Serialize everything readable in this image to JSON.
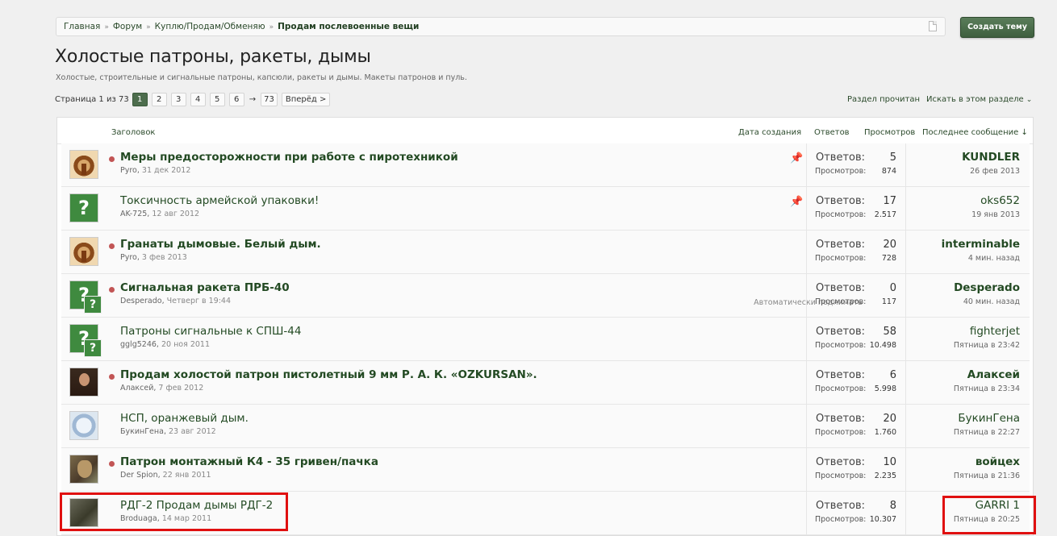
{
  "breadcrumb": {
    "items": [
      "Главная",
      "Форум",
      "Куплю/Продам/Обменяю"
    ],
    "current": "Продам послевоенные вещи"
  },
  "create_button": "Создать тему",
  "title": "Холостые патроны, ракеты, дымы",
  "description": "Холостые, строительные и сигнальные патроны, капсюли, ракеты и дымы. Макеты патронов и пуль.",
  "pagination": {
    "label": "Страница 1 из 73",
    "pages": [
      "1",
      "2",
      "3",
      "4",
      "5",
      "6"
    ],
    "current": "1",
    "arrow": "→",
    "last": "73",
    "next": "Вперёд >"
  },
  "links": {
    "mark_read": "Раздел прочитан",
    "search_section": "Искать в этом разделе"
  },
  "columns": {
    "title": "Заголовок",
    "created": "Дата создания",
    "replies": "Ответов",
    "views": "Просмотров",
    "last_post": "Последнее сообщение ↓"
  },
  "stat_labels": {
    "replies": "Ответов:",
    "views": "Просмотров:"
  },
  "threads": [
    {
      "title": "Меры предосторожности при работе с пиротехникой",
      "author": "Pyro",
      "date": "31 дек 2012",
      "replies": "5",
      "views": "874",
      "last_user": "KUNDLER",
      "last_time": "26 фев 2013",
      "unread": true,
      "sticky": true,
      "avatar": "pyro-avatar"
    },
    {
      "title": "Токсичность армейской упаковки!",
      "author": "AK-725",
      "date": "12 авг 2012",
      "replies": "17",
      "views": "2.517",
      "last_user": "oks652",
      "last_time": "19 янв 2013",
      "unread": false,
      "sticky": true,
      "avatar": "question-avatar"
    },
    {
      "title": "Гранаты дымовые. Белый дым.",
      "author": "Pyro",
      "date": "3 фев 2013",
      "replies": "20",
      "views": "728",
      "last_user": "interminable",
      "last_time": "4 мин. назад",
      "unread": true,
      "sticky": false,
      "avatar": "pyro-avatar"
    },
    {
      "title": "Сигнальная ракета ПРБ-40",
      "author": "Desperado",
      "date": "Четверг в 19:44",
      "replies": "0",
      "views": "117",
      "last_user": "Desperado",
      "last_time": "40 мин. назад",
      "unread": true,
      "sticky": false,
      "avatar": "question-avatar",
      "note": "Автоматически поднимать"
    },
    {
      "title": "Патроны сигнальные к СПШ-44",
      "author": "gglg5246",
      "date": "20 ноя 2011",
      "replies": "58",
      "views": "10.498",
      "last_user": "fighterjet",
      "last_time": "Пятница в 23:42",
      "unread": false,
      "sticky": false,
      "avatar": "question-avatar"
    },
    {
      "title": "Продам холостой патрон пистолетный 9 мм Р. А. К. «OZKURSAN».",
      "author": "Алаксей",
      "date": "7 фев 2012",
      "replies": "6",
      "views": "5.998",
      "last_user": "Алаксей",
      "last_time": "Пятница в 23:34",
      "unread": true,
      "sticky": false,
      "avatar": "man-avatar"
    },
    {
      "title": "НСП, оранжевый дым.",
      "author": "БукинГена",
      "date": "23 авг 2012",
      "replies": "20",
      "views": "1.760",
      "last_user": "БукинГена",
      "last_time": "Пятница в 22:27",
      "unread": false,
      "sticky": false,
      "avatar": "logo-avatar"
    },
    {
      "title": "Патрон монтажный К4 - 35 гривен/пачка",
      "author": "Der Spion",
      "date": "22 янв 2011",
      "replies": "10",
      "views": "2.235",
      "last_user": "войцех",
      "last_time": "Пятница в 21:36",
      "unread": true,
      "sticky": false,
      "avatar": "dog-avatar"
    },
    {
      "title": "РДГ-2 Продам дымы РДГ-2",
      "author": "Broduaga",
      "date": "14 мар 2011",
      "replies": "8",
      "views": "10.307",
      "last_user": "GARRI 1",
      "last_time": "Пятница в 20:25",
      "unread": false,
      "sticky": false,
      "avatar": "monkey-avatar"
    }
  ],
  "colors": {
    "accent": "#234a23",
    "button": "#4d6d4d",
    "highlight": "#e01010",
    "unread_dot": "#c25555"
  }
}
